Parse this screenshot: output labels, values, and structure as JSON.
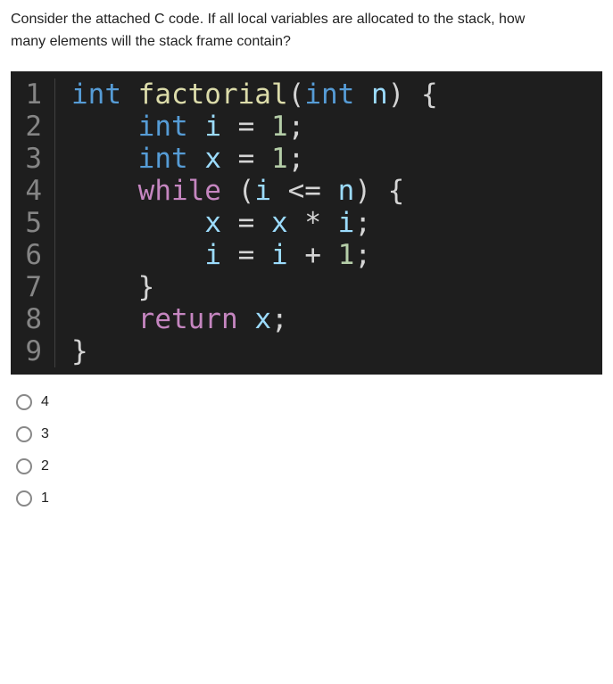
{
  "question": {
    "line1": "Consider the attached C code. If all local variables are allocated to the stack, how",
    "line2": "many elements will the stack frame contain?"
  },
  "code": {
    "lines": [
      {
        "num": "1",
        "tokens": [
          {
            "t": "int ",
            "c": "kw"
          },
          {
            "t": "factorial",
            "c": "fn"
          },
          {
            "t": "(",
            "c": "pun"
          },
          {
            "t": "int ",
            "c": "kw"
          },
          {
            "t": "n",
            "c": "var"
          },
          {
            "t": ")",
            "c": "pun"
          },
          {
            "t": " {",
            "c": "pun"
          }
        ]
      },
      {
        "num": "2",
        "tokens": [
          {
            "t": "    ",
            "c": "op"
          },
          {
            "t": "int ",
            "c": "kw"
          },
          {
            "t": "i",
            "c": "var"
          },
          {
            "t": " = ",
            "c": "op"
          },
          {
            "t": "1",
            "c": "num"
          },
          {
            "t": ";",
            "c": "pun"
          }
        ]
      },
      {
        "num": "3",
        "tokens": [
          {
            "t": "    ",
            "c": "op"
          },
          {
            "t": "int ",
            "c": "kw"
          },
          {
            "t": "x",
            "c": "var"
          },
          {
            "t": " = ",
            "c": "op"
          },
          {
            "t": "1",
            "c": "num"
          },
          {
            "t": ";",
            "c": "pun"
          }
        ]
      },
      {
        "num": "4",
        "tokens": [
          {
            "t": "    ",
            "c": "op"
          },
          {
            "t": "while",
            "c": "ctrl"
          },
          {
            "t": " (",
            "c": "pun"
          },
          {
            "t": "i",
            "c": "var"
          },
          {
            "t": " <= ",
            "c": "op"
          },
          {
            "t": "n",
            "c": "var"
          },
          {
            "t": ")",
            "c": "pun"
          },
          {
            "t": " {",
            "c": "pun"
          }
        ]
      },
      {
        "num": "5",
        "tokens": [
          {
            "t": "        ",
            "c": "op"
          },
          {
            "t": "x",
            "c": "var"
          },
          {
            "t": " = ",
            "c": "op"
          },
          {
            "t": "x",
            "c": "var"
          },
          {
            "t": " * ",
            "c": "op"
          },
          {
            "t": "i",
            "c": "var"
          },
          {
            "t": ";",
            "c": "pun"
          }
        ]
      },
      {
        "num": "6",
        "tokens": [
          {
            "t": "        ",
            "c": "op"
          },
          {
            "t": "i",
            "c": "var"
          },
          {
            "t": " = ",
            "c": "op"
          },
          {
            "t": "i",
            "c": "var"
          },
          {
            "t": " + ",
            "c": "op"
          },
          {
            "t": "1",
            "c": "num"
          },
          {
            "t": ";",
            "c": "pun"
          }
        ]
      },
      {
        "num": "7",
        "tokens": [
          {
            "t": "    }",
            "c": "pun"
          }
        ]
      },
      {
        "num": "8",
        "tokens": [
          {
            "t": "    ",
            "c": "op"
          },
          {
            "t": "return",
            "c": "ctrl"
          },
          {
            "t": " ",
            "c": "op"
          },
          {
            "t": "x",
            "c": "var"
          },
          {
            "t": ";",
            "c": "pun"
          }
        ]
      },
      {
        "num": "9",
        "tokens": [
          {
            "t": "}",
            "c": "pun"
          }
        ]
      }
    ]
  },
  "options": [
    {
      "label": "4"
    },
    {
      "label": "3"
    },
    {
      "label": "2"
    },
    {
      "label": "1"
    }
  ]
}
